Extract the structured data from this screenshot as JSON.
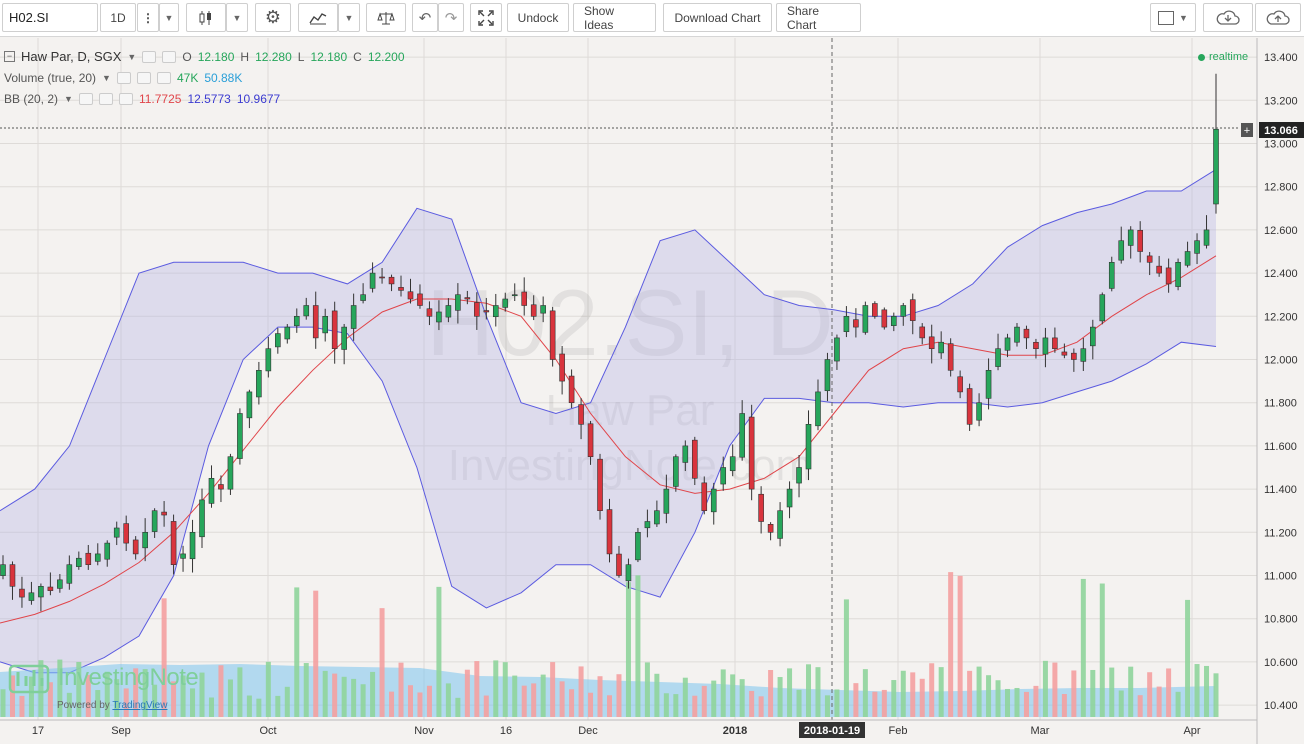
{
  "toolbar": {
    "symbol": "H02.SI",
    "interval": "1D",
    "undock": "Undock",
    "show_ideas": "Show Ideas",
    "download_chart": "Download Chart",
    "share_chart": "Share Chart"
  },
  "legend": {
    "main_name": "Haw Par, D, SGX",
    "o_label": "O",
    "o_value": "12.180",
    "h_label": "H",
    "h_value": "12.280",
    "l_label": "L",
    "l_value": "12.180",
    "c_label": "C",
    "c_value": "12.200",
    "volume_name": "Volume (true, 20)",
    "volume_value": "47K",
    "volume_ma": "50.88K",
    "bb_name": "BB (20, 2)",
    "bb_basis": "11.7725",
    "bb_upper": "12.5773",
    "bb_lower": "10.9677"
  },
  "realtime": "realtime",
  "watermark": {
    "line1": "H02.SI, D",
    "line2": "Haw Par",
    "line3": "InvestingNote.com"
  },
  "logo": {
    "name": "InvestingNote",
    "powered_by": "Powered by",
    "powered_link": "TradingView"
  },
  "price_axis": [
    "13.400",
    "13.200",
    "13.000",
    "12.800",
    "12.600",
    "12.400",
    "12.200",
    "12.000",
    "11.800",
    "11.600",
    "11.400",
    "11.200",
    "11.000",
    "10.800",
    "10.600",
    "10.400"
  ],
  "current_price": "13.066",
  "time_axis": [
    "17",
    "Sep",
    "Oct",
    "Nov",
    "16",
    "Dec",
    "2018",
    "Feb",
    "Mar",
    "Apr"
  ],
  "crosshair_date": "2018-01-19",
  "colors": {
    "up": "#26a65b",
    "down": "#d9343d",
    "band": "#5b5be0",
    "basis": "#e0454a",
    "volume_up": "#8fd49b",
    "volume_down": "#f4a0a0"
  },
  "chart_data": {
    "type": "candlestick",
    "symbol": "H02.SI",
    "title": "Haw Par, D, SGX",
    "y_range": [
      10.35,
      13.45
    ],
    "close_series_approx": [
      11.05,
      10.95,
      10.9,
      10.92,
      10.95,
      10.93,
      10.98,
      11.05,
      11.08,
      11.05,
      11.1,
      11.15,
      11.22,
      11.15,
      11.1,
      11.2,
      11.3,
      11.28,
      11.05,
      11.1,
      11.2,
      11.35,
      11.45,
      11.4,
      11.55,
      11.75,
      11.85,
      11.95,
      12.05,
      12.12,
      12.15,
      12.2,
      12.25,
      12.1,
      12.2,
      12.05,
      12.15,
      12.25,
      12.3,
      12.4,
      12.38,
      12.35,
      12.32,
      12.28,
      12.25,
      12.2,
      12.22,
      12.25,
      12.3,
      12.28,
      12.2,
      12.22,
      12.25,
      12.28,
      12.3,
      12.25,
      12.2,
      12.25,
      12.0,
      11.9,
      11.8,
      11.7,
      11.55,
      11.3,
      11.1,
      11.0,
      11.05,
      11.2,
      11.25,
      11.3,
      11.4,
      11.55,
      11.6,
      11.45,
      11.3,
      11.4,
      11.5,
      11.55,
      11.75,
      11.4,
      11.25,
      11.2,
      11.3,
      11.4,
      11.5,
      11.7,
      11.85,
      12.0,
      12.1,
      12.2,
      12.15,
      12.25,
      12.2,
      12.15,
      12.2,
      12.25,
      12.18,
      12.1,
      12.05,
      12.08,
      11.95,
      11.85,
      11.7,
      11.8,
      11.95,
      12.05,
      12.1,
      12.15,
      12.1,
      12.05,
      12.1,
      12.05,
      12.02,
      12.0,
      12.05,
      12.15,
      12.3,
      12.45,
      12.55,
      12.6,
      12.5,
      12.45,
      12.4,
      12.35,
      12.45,
      12.5,
      12.55,
      12.6,
      13.066
    ],
    "bb_basis_series_approx": [
      10.78,
      10.82,
      10.88,
      10.96,
      11.06,
      11.2,
      11.38,
      11.58,
      11.78,
      11.95,
      12.1,
      12.22,
      12.28,
      12.28,
      12.26,
      12.2,
      12.0,
      11.75,
      11.55,
      11.42,
      11.38,
      11.4,
      11.45,
      11.55,
      11.75,
      11.95,
      12.05,
      12.08,
      12.05,
      12.02,
      12.02,
      12.08,
      12.2,
      12.3,
      12.38,
      12.48
    ],
    "bb_upper_series_approx": [
      11.3,
      11.4,
      11.6,
      12.0,
      12.4,
      12.45,
      12.45,
      12.45,
      12.4,
      12.4,
      12.35,
      12.45,
      12.7,
      12.65,
      12.2,
      11.8,
      11.75,
      11.8,
      12.15,
      12.55,
      12.6,
      12.45,
      12.3,
      12.25,
      12.23,
      12.2,
      12.2,
      12.25,
      12.35,
      12.52,
      12.62,
      12.68,
      12.72,
      12.78,
      12.78,
      12.88
    ],
    "bb_lower_series_approx": [
      10.6,
      10.55,
      10.55,
      10.62,
      10.72,
      11.0,
      11.6,
      12.0,
      12.15,
      12.15,
      12.12,
      11.9,
      11.5,
      10.95,
      10.85,
      10.92,
      11.05,
      11.05,
      10.95,
      10.9,
      11.2,
      11.6,
      11.82,
      11.82,
      11.8,
      11.8,
      11.78,
      11.8,
      11.8,
      11.78,
      11.8,
      11.85,
      11.9,
      11.98,
      12.08,
      12.06
    ],
    "last_volume": "47K",
    "volume_ma": "50.88K"
  }
}
